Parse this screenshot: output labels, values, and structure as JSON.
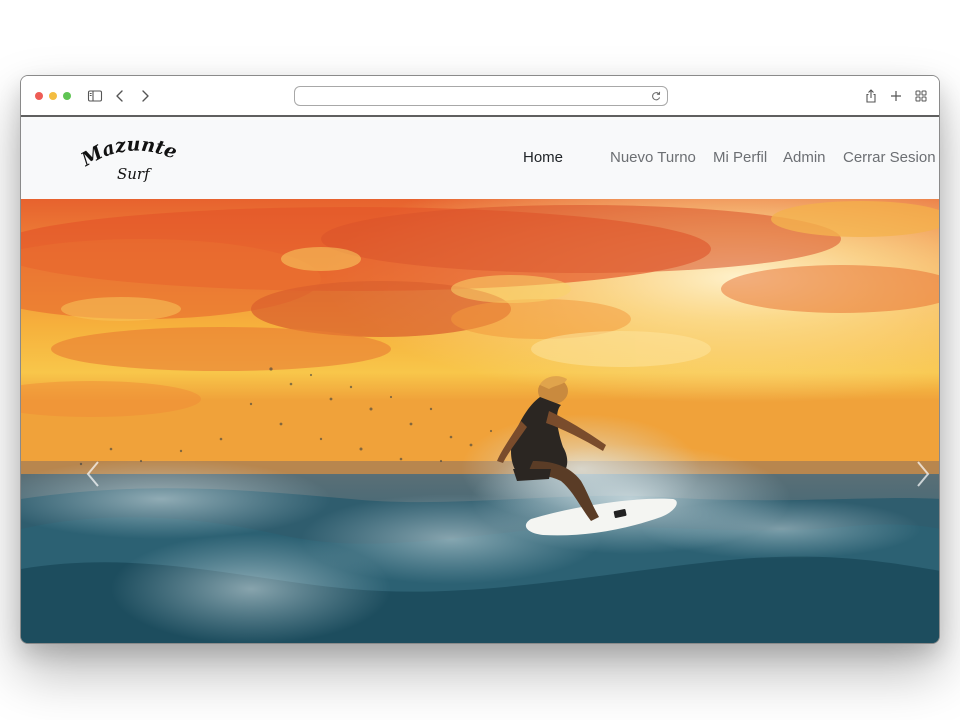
{
  "browser": {
    "address_value": "",
    "icons": [
      "sidebar-toggle-icon",
      "chevron-left-icon",
      "chevron-right-icon",
      "reload-icon",
      "share-icon",
      "plus-icon",
      "tab-grid-icon"
    ]
  },
  "site": {
    "logo_text": "Mazunte Surf",
    "nav": {
      "home": "Home",
      "nuevo_turno": "Nuevo Turno",
      "mi_perfil": "Mi Perfil",
      "admin": "Admin",
      "cerrar_sesion": "Cerrar Sesion"
    }
  },
  "colors": {
    "navbar_bg": "#f8f9fa",
    "nav_link": "#6c6f73",
    "nav_link_active": "#212529",
    "sunset_orange": "#ec7a3c",
    "ocean_teal": "#2e5868"
  }
}
